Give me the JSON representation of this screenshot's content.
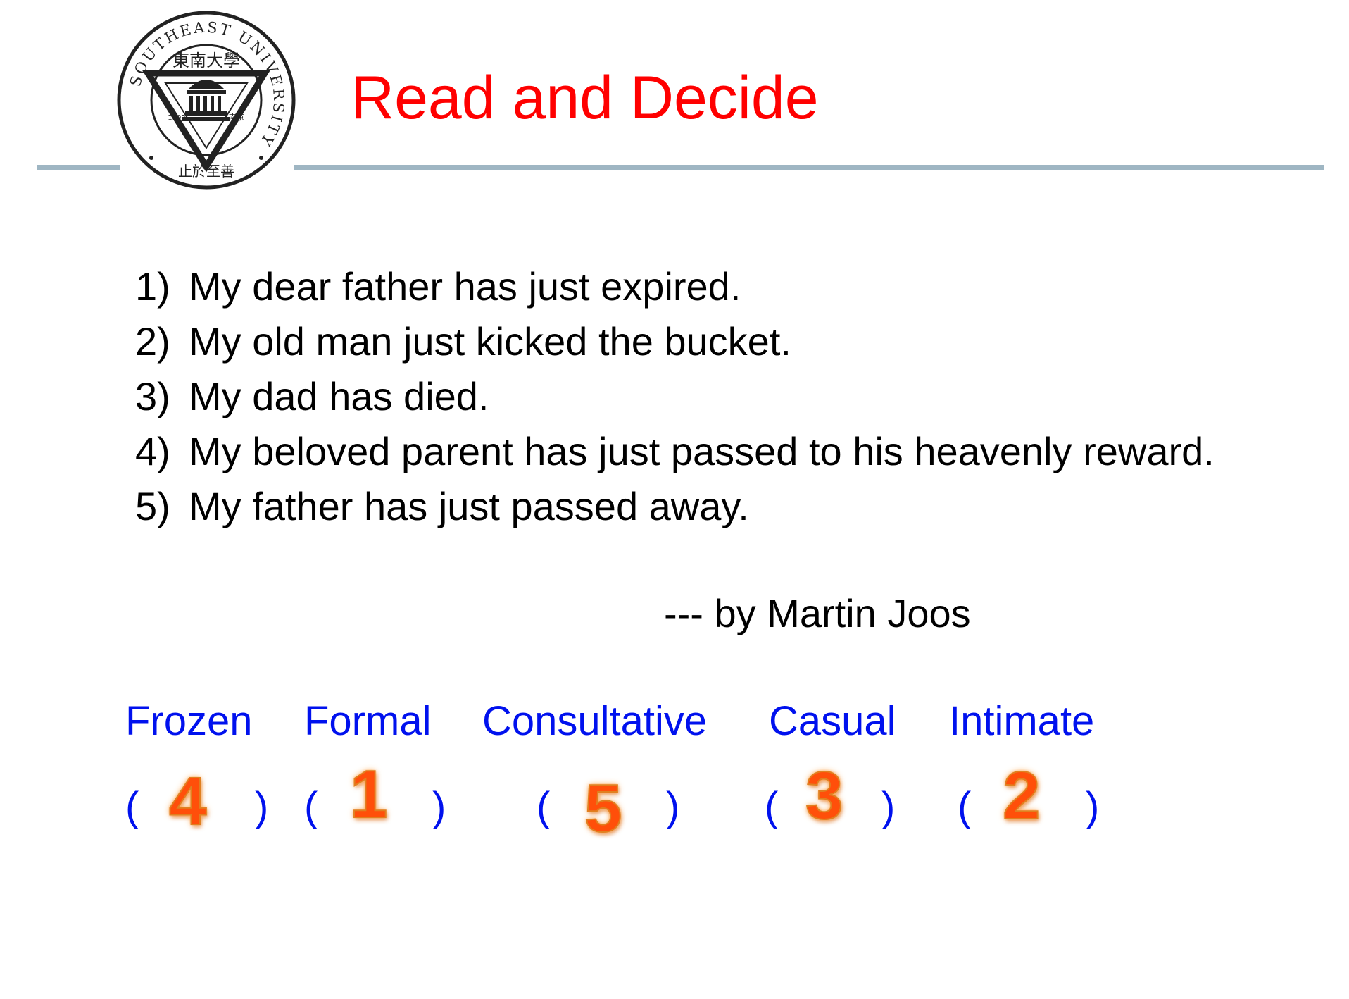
{
  "logo": {
    "name": "southeast-university-seal",
    "ring_text": "SOUTHEAST UNIVERSITY",
    "chinese_name": "東南大學",
    "year": "1902",
    "city": "南京",
    "motto": "止於至善"
  },
  "slide": {
    "title": "Read and Decide",
    "sentences": [
      {
        "num": "1)",
        "text": "My dear father has just expired."
      },
      {
        "num": "2)",
        "text": "My old man just kicked the bucket."
      },
      {
        "num": "3)",
        "text": "My dad has died."
      },
      {
        "num": "4)",
        "text": "My beloved parent has just passed to his heavenly reward."
      },
      {
        "num": "5)",
        "text": "My father has just passed away."
      }
    ],
    "author": "--- by Martin Joos",
    "styles": [
      {
        "label": "Frozen",
        "answer": "4"
      },
      {
        "label": "Formal",
        "answer": "1"
      },
      {
        "label": "Consultative",
        "answer": "5"
      },
      {
        "label": "Casual",
        "answer": "3"
      },
      {
        "label": "Intimate",
        "answer": "2"
      }
    ],
    "open_paren": "(",
    "close_paren": ")"
  },
  "colors": {
    "title": "#ff0000",
    "styles": "#0011ee",
    "answers": "#ff4f0a",
    "rule": "#9fb6c3"
  }
}
